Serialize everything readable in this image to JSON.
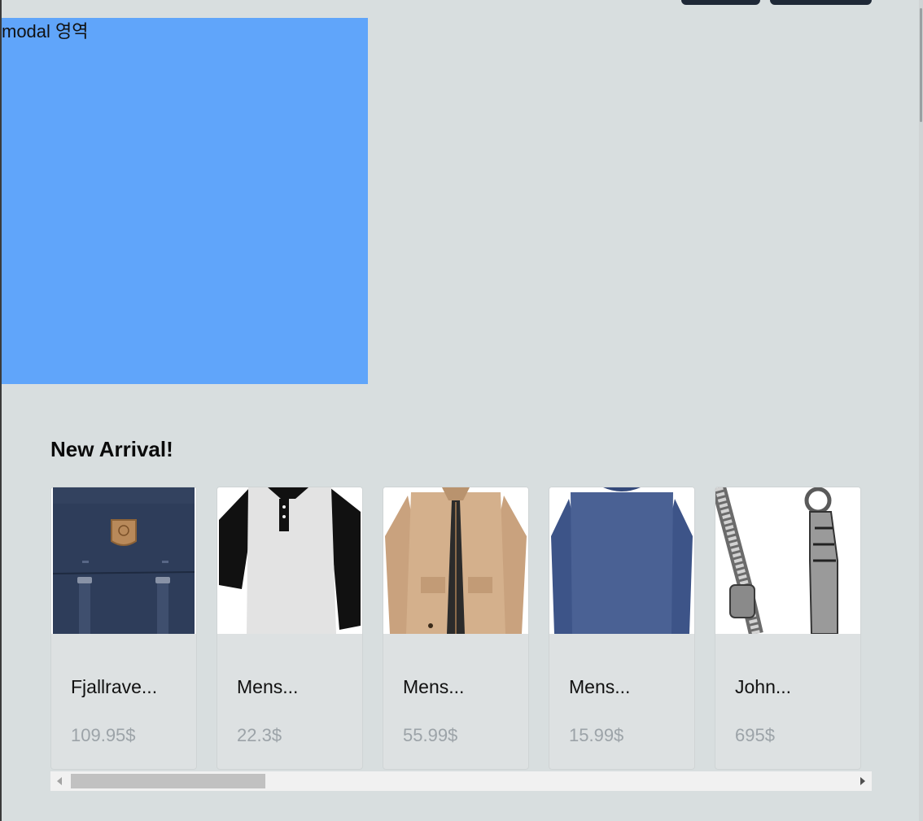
{
  "modal": {
    "label": "modal 영역",
    "color": "#60a5fa"
  },
  "section": {
    "title": "New Arrival!"
  },
  "products": [
    {
      "name": "Fjallrave...",
      "price": "109.95$",
      "image": "navy-backpack"
    },
    {
      "name": "Mens...",
      "price": "22.3$",
      "image": "raglan-tshirt"
    },
    {
      "name": "Mens...",
      "price": "55.99$",
      "image": "khaki-jacket"
    },
    {
      "name": "Mens...",
      "price": "15.99$",
      "image": "blue-longsleeve"
    },
    {
      "name": "John...",
      "price": "695$",
      "image": "silver-bracelet"
    }
  ],
  "colors": {
    "background": "#d8dedf",
    "button": "#1f2937"
  }
}
